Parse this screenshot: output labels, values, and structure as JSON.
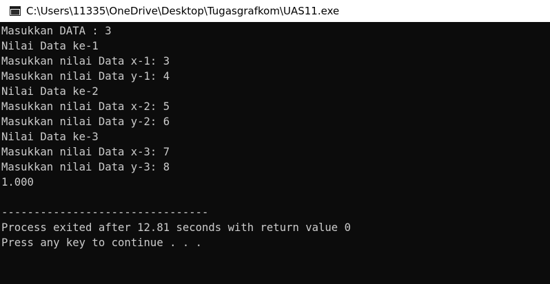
{
  "window": {
    "title": "C:\\Users\\11335\\OneDrive\\Desktop\\Tugasgrafkom\\UAS11.exe",
    "icon": "console-window-icon"
  },
  "console": {
    "lines": [
      "Masukkan DATA : 3",
      "Nilai Data ke-1",
      "Masukkan nilai Data x-1: 3",
      "Masukkan nilai Data y-1: 4",
      "Nilai Data ke-2",
      "Masukkan nilai Data x-2: 5",
      "Masukkan nilai Data y-2: 6",
      "Nilai Data ke-3",
      "Masukkan nilai Data x-3: 7",
      "Masukkan nilai Data y-3: 8",
      "1.000",
      "",
      "--------------------------------",
      "Process exited after 12.81 seconds with return value 0",
      "Press any key to continue . . ."
    ],
    "text_color": "#cccccc",
    "background_color": "#0c0c0c"
  }
}
